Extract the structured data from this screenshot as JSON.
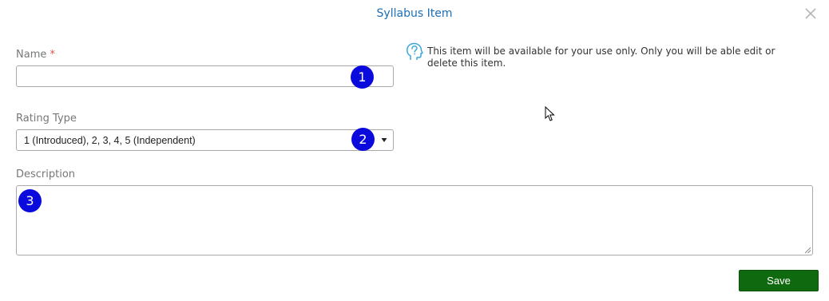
{
  "dialog": {
    "title": "Syllabus Item",
    "close_icon": "close-icon"
  },
  "name_field": {
    "label": "Name",
    "required_marker": "*",
    "value": "",
    "placeholder": ""
  },
  "rating_type": {
    "label": "Rating Type",
    "selected": "1 (Introduced), 2, 3, 4, 5 (Independent)",
    "arrow": "▾"
  },
  "description": {
    "label": "Description",
    "value": ""
  },
  "info": {
    "icon": "question-head-icon",
    "text": "This item will be available for your use only. Only you will be able edit or delete this item."
  },
  "badges": [
    "1",
    "2",
    "3"
  ],
  "actions": {
    "save_label": "Save"
  },
  "colors": {
    "title": "#1b6fb5",
    "required": "#d9534f",
    "badge": "#0a0adc",
    "save_button": "#0f6a0f",
    "info_icon": "#3aa6d8"
  }
}
